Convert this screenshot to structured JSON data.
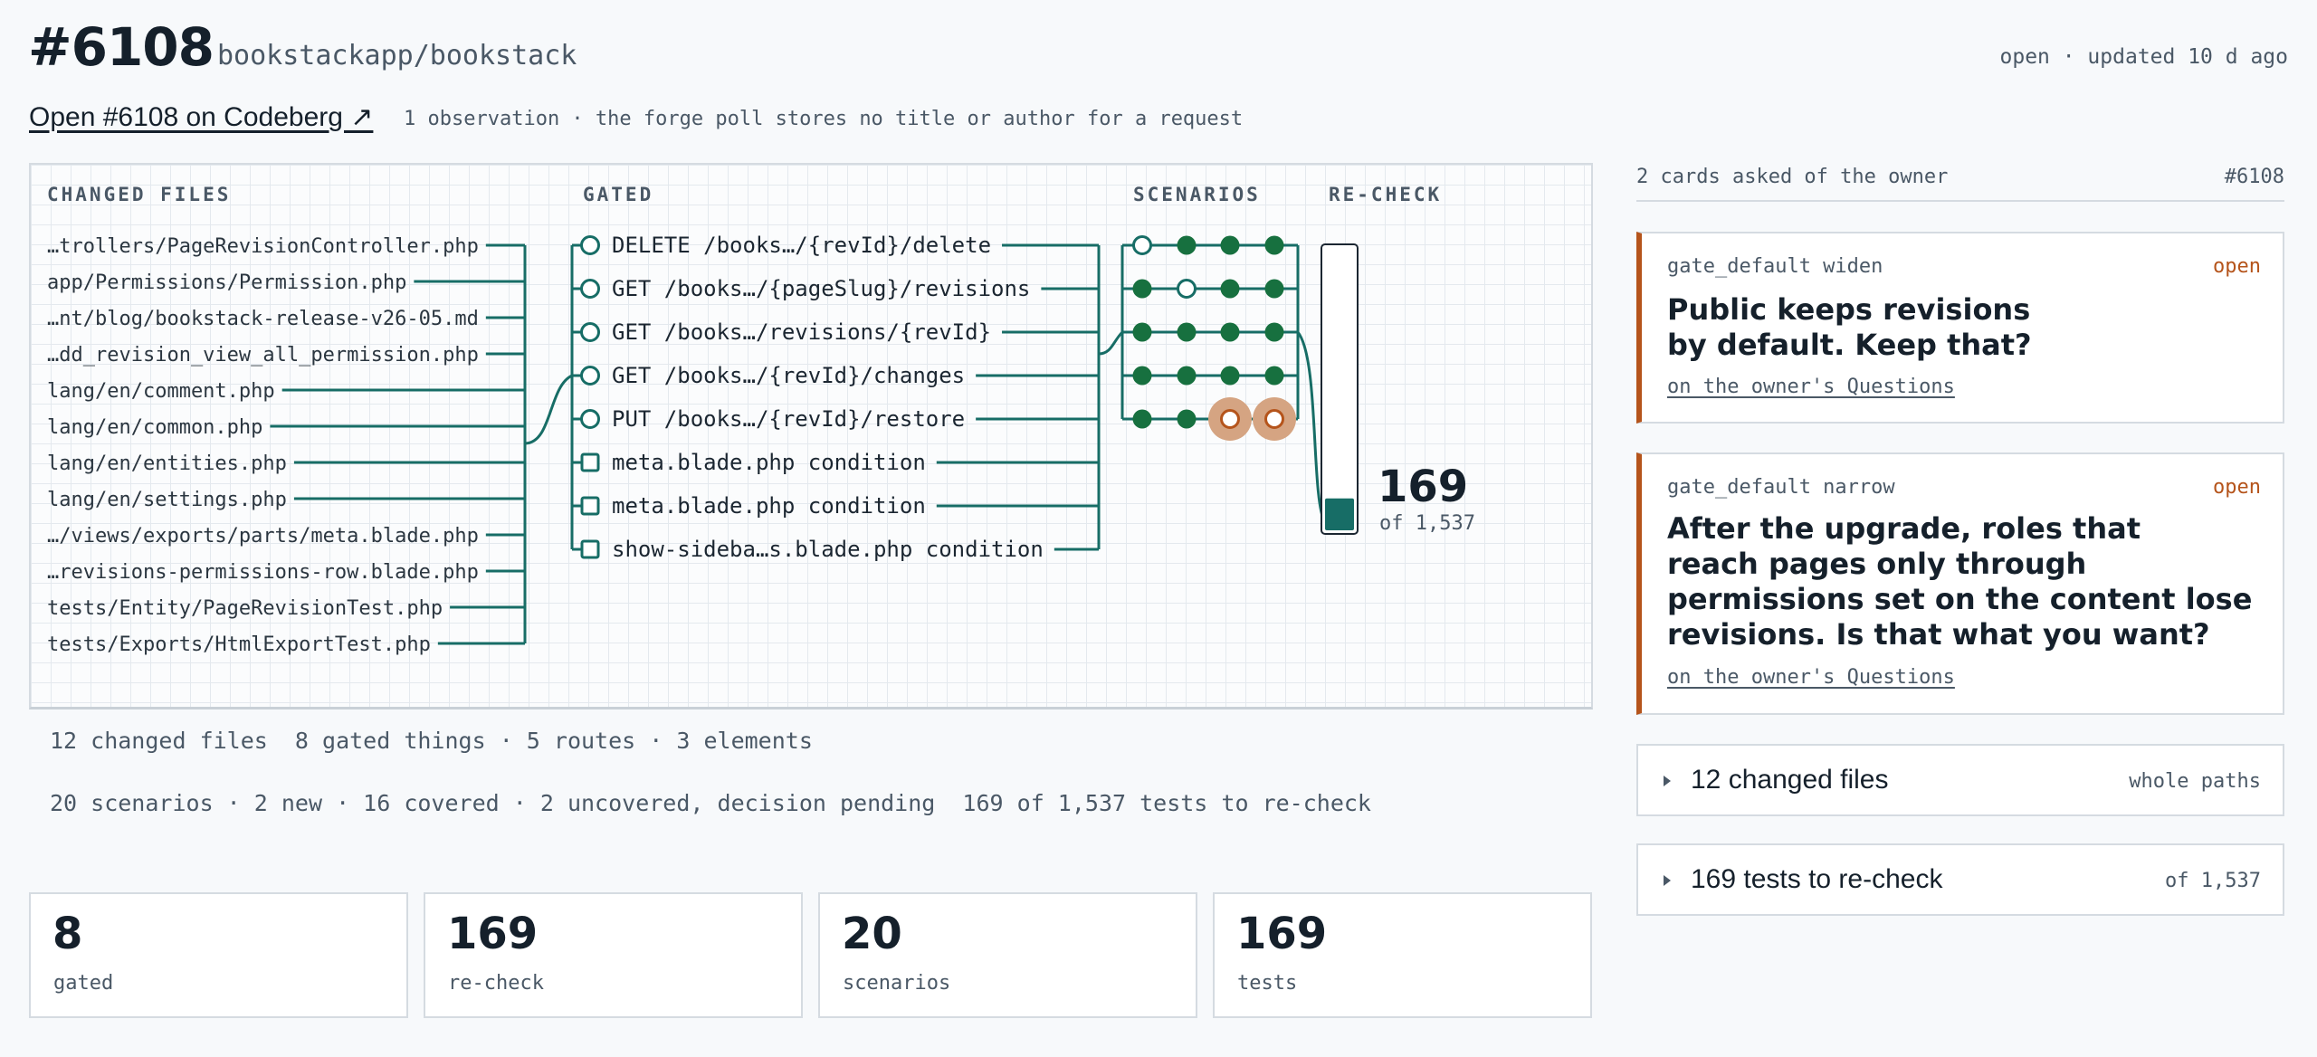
{
  "header": {
    "number": "#6108",
    "repo": "bookstackapp/bookstack",
    "status": "open · updated 10 d ago",
    "open_link": "Open #6108 on Codeberg ↗",
    "observation": "1 observation · the forge poll stores no title or author for a request"
  },
  "diagram": {
    "headers": {
      "changed_files": "CHANGED FILES",
      "gated": "GATED",
      "scenarios": "SCENARIOS",
      "recheck": "RE-CHECK"
    },
    "files": [
      "…trollers/PageRevisionController.php",
      "app/Permissions/Permission.php",
      "…nt/blog/bookstack-release-v26-05.md",
      "…dd_revision_view_all_permission.php",
      "lang/en/comment.php",
      "lang/en/common.php",
      "lang/en/entities.php",
      "lang/en/settings.php",
      "…/views/exports/parts/meta.blade.php",
      "…revisions-permissions-row.blade.php",
      "tests/Entity/PageRevisionTest.php",
      "tests/Exports/HtmlExportTest.php"
    ],
    "gated": [
      {
        "kind": "route",
        "label": "DELETE /books…/{revId}/delete"
      },
      {
        "kind": "route",
        "label": "GET /books…/{pageSlug}/revisions"
      },
      {
        "kind": "route",
        "label": "GET /books…/revisions/{revId}"
      },
      {
        "kind": "route",
        "label": "GET /books…/{revId}/changes"
      },
      {
        "kind": "route",
        "label": "PUT /books…/{revId}/restore"
      },
      {
        "kind": "element",
        "label": "meta.blade.php condition"
      },
      {
        "kind": "element",
        "label": "meta.blade.php condition"
      },
      {
        "kind": "element",
        "label": "show-sideba…s.blade.php condition"
      }
    ],
    "scenario_rows": [
      [
        "new",
        "covered",
        "covered",
        "covered"
      ],
      [
        "covered",
        "new",
        "covered",
        "covered"
      ],
      [
        "covered",
        "covered",
        "covered",
        "covered"
      ],
      [
        "covered",
        "covered",
        "covered",
        "covered"
      ],
      [
        "covered",
        "covered",
        "uncovered",
        "uncovered"
      ]
    ],
    "recheck": {
      "value": "169",
      "of": "of 1,537",
      "fraction": 0.11
    }
  },
  "summary": {
    "line1": "12 changed files  8 gated things · 5 routes · 3 elements",
    "line2": "20 scenarios · 2 new · 16 covered · 2 uncovered, decision pending  169 of 1,537 tests to re-check"
  },
  "stats": [
    {
      "value": "8",
      "label": "gated"
    },
    {
      "value": "169",
      "label": "re-check"
    },
    {
      "value": "20",
      "label": "scenarios"
    },
    {
      "value": "169",
      "label": "tests"
    }
  ],
  "cards": {
    "title": "2 cards asked of the owner",
    "number": "#6108",
    "items": [
      {
        "tag": "gate_default widen",
        "state": "open",
        "text": [
          "Public keeps revisions",
          "by default. Keep that?"
        ],
        "link": "on the owner's Questions"
      },
      {
        "tag": "gate_default narrow",
        "state": "open",
        "text": [
          "After the upgrade, roles that",
          "reach pages only through",
          "permissions set on the content lose",
          "revisions. Is that what you want?"
        ],
        "link": "on the owner's Questions"
      }
    ]
  },
  "collapsibles": [
    {
      "label": "12 changed files",
      "hint": "whole paths"
    },
    {
      "label": "169 tests to re-check",
      "hint": "of 1,537"
    }
  ],
  "colors": {
    "teal": "#176d66",
    "green": "#17703f",
    "orange": "#b5541b",
    "uncovered_halo": "#d5a482"
  }
}
